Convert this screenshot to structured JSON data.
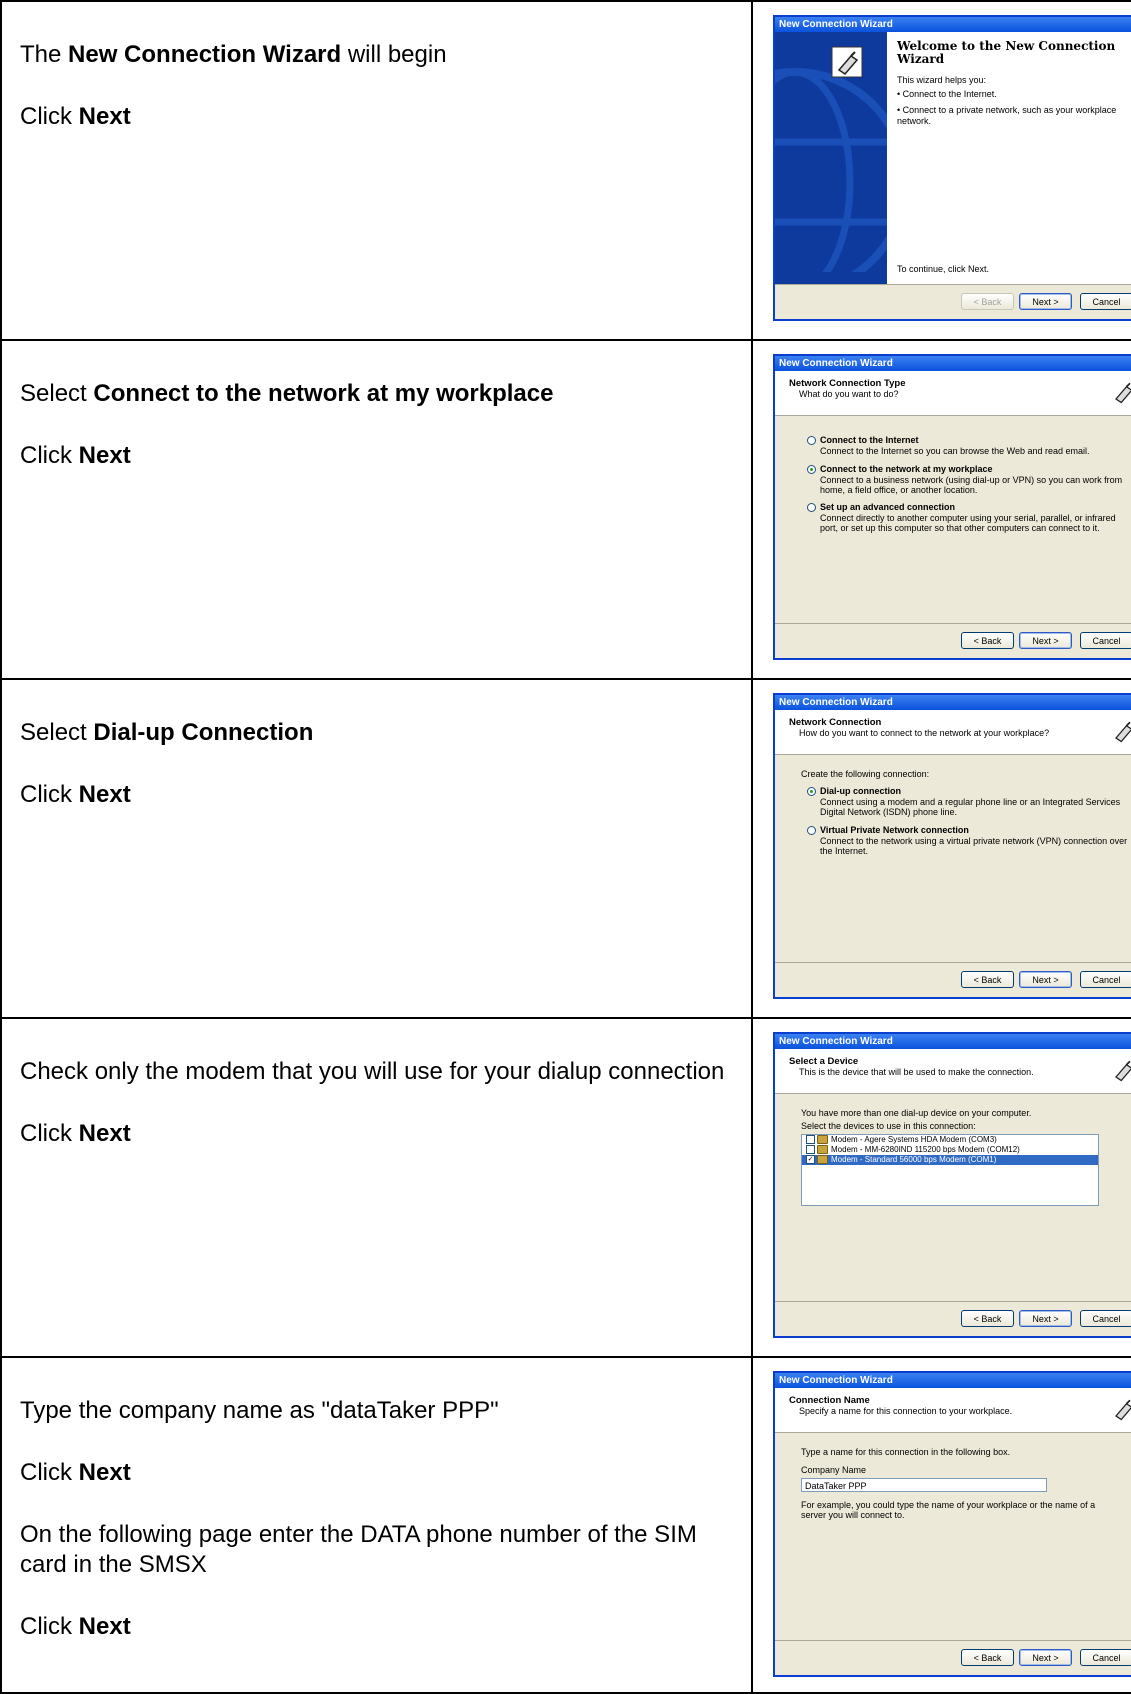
{
  "rows": [
    {
      "instructions": [
        {
          "pre": "The ",
          "bold": "New Connection Wizard",
          "post": " will begin"
        },
        {
          "pre": "Click ",
          "bold": "Next",
          "post": ""
        }
      ],
      "window": {
        "title": "New Connection Wizard",
        "welcome_title": "Welcome to the New Connection Wizard",
        "helps": "This wizard helps you:",
        "bullets": [
          "Connect to the Internet.",
          "Connect to a private network, such as your workplace network."
        ],
        "continue": "To continue, click Next."
      }
    },
    {
      "instructions": [
        {
          "pre": "Select ",
          "bold": "Connect to the network at my workplace",
          "post": ""
        },
        {
          "pre": "Click ",
          "bold": "Next",
          "post": ""
        }
      ],
      "window": {
        "title": "New Connection Wizard",
        "header_title": "Network Connection Type",
        "header_sub": "What do you want to do?",
        "options": [
          {
            "label": "Connect to the Internet",
            "desc": "Connect to the Internet so you can browse the Web and read email.",
            "selected": false
          },
          {
            "label": "Connect to the network at my workplace",
            "desc": "Connect to a business network (using dial-up or VPN) so you can work from home, a field office, or another location.",
            "selected": true
          },
          {
            "label": "Set up an advanced connection",
            "desc": "Connect directly to another computer using your serial, parallel, or infrared port, or set up this computer so that other computers can connect to it.",
            "selected": false
          }
        ]
      }
    },
    {
      "instructions": [
        {
          "pre": "Select ",
          "bold": "Dial-up Connection",
          "post": ""
        },
        {
          "pre": "Click ",
          "bold": "Next",
          "post": ""
        }
      ],
      "window": {
        "title": "New Connection Wizard",
        "header_title": "Network Connection",
        "header_sub": "How do you want to connect to the network at your workplace?",
        "intro": "Create the following connection:",
        "options": [
          {
            "label": "Dial-up connection",
            "desc": "Connect using a modem and a regular phone line or an Integrated Services Digital Network (ISDN) phone line.",
            "selected": true
          },
          {
            "label": "Virtual Private Network connection",
            "desc": "Connect to the network using a virtual private network (VPN) connection over the Internet.",
            "selected": false
          }
        ]
      }
    },
    {
      "instructions": [
        {
          "pre": "Check only the modem that you will use for your dialup connection",
          "bold": "",
          "post": ""
        },
        {
          "pre": "Click ",
          "bold": "Next",
          "post": ""
        }
      ],
      "window": {
        "title": "New Connection Wizard",
        "header_title": "Select a Device",
        "header_sub": "This is the device that will be used to make the connection.",
        "line1": "You have more than one dial-up device on your computer.",
        "line2": "Select the devices to use in this connection:",
        "devices": [
          {
            "name": "Modem - Agere Systems HDA Modem (COM3)",
            "checked": false
          },
          {
            "name": "Modem - MM-6280IND 115200 bps Modem (COM12)",
            "checked": false
          },
          {
            "name": "Modem - Standard 56000 bps Modem (COM1)",
            "checked": true
          }
        ]
      }
    },
    {
      "instructions": [
        {
          "pre": "Type the company name as \"dataTaker PPP\"",
          "bold": "",
          "post": ""
        },
        {
          "pre": "Click ",
          "bold": "Next",
          "post": ""
        },
        {
          "pre": "On the following page enter the DATA phone number of the SIM card in the SMSX",
          "bold": "",
          "post": ""
        },
        {
          "pre": "Click ",
          "bold": "Next",
          "post": ""
        }
      ],
      "window": {
        "title": "New Connection Wizard",
        "header_title": "Connection Name",
        "header_sub": "Specify a name for this connection to your workplace.",
        "line1": "Type a name for this connection in the following box.",
        "field_label": "Company Name",
        "field_value": "DataTaker PPP",
        "example": "For example, you could type the name of your workplace or the name of a server you will connect to."
      }
    }
  ],
  "buttons": {
    "back": "< Back",
    "next": "Next >",
    "cancel": "Cancel"
  }
}
